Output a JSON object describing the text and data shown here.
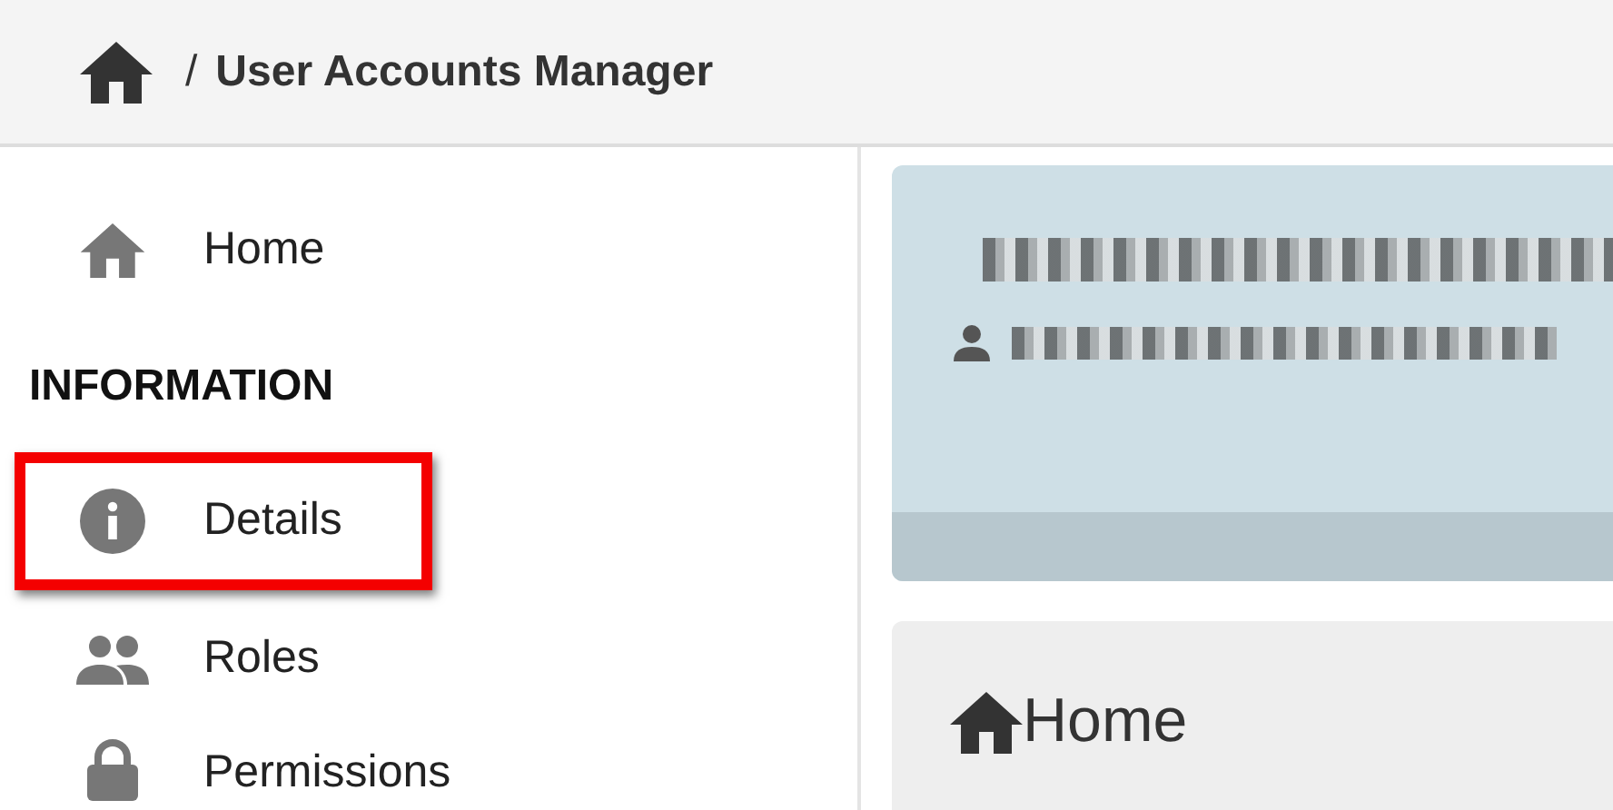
{
  "breadcrumb": {
    "separator": "/",
    "title": "User Accounts Manager"
  },
  "sidebar": {
    "items": [
      {
        "kind": "link",
        "label": "Home",
        "highlighted": false
      },
      {
        "kind": "heading",
        "label": "INFORMATION"
      },
      {
        "kind": "link",
        "label": "Details",
        "highlighted": true
      },
      {
        "kind": "link",
        "label": "Roles",
        "highlighted": false
      },
      {
        "kind": "link",
        "label": "Permissions",
        "highlighted": false
      }
    ]
  },
  "home_panel": {
    "title": "Home"
  }
}
